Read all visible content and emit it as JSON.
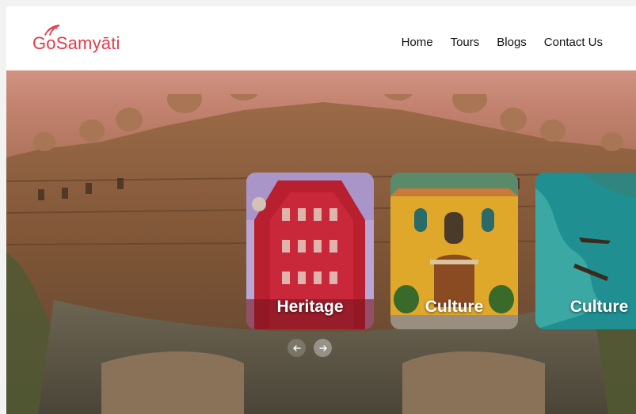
{
  "brand": {
    "name": "GoSamyāti",
    "color": "#e23b4a"
  },
  "nav": {
    "items": [
      {
        "label": "Home"
      },
      {
        "label": "Tours"
      },
      {
        "label": "Blogs"
      },
      {
        "label": "Contact Us"
      }
    ]
  },
  "carousel": {
    "cards": [
      {
        "label": "Heritage"
      },
      {
        "label": "Culture"
      },
      {
        "label": "Culture"
      }
    ],
    "prev_icon": "arrow-left-icon",
    "next_icon": "arrow-right-icon"
  }
}
